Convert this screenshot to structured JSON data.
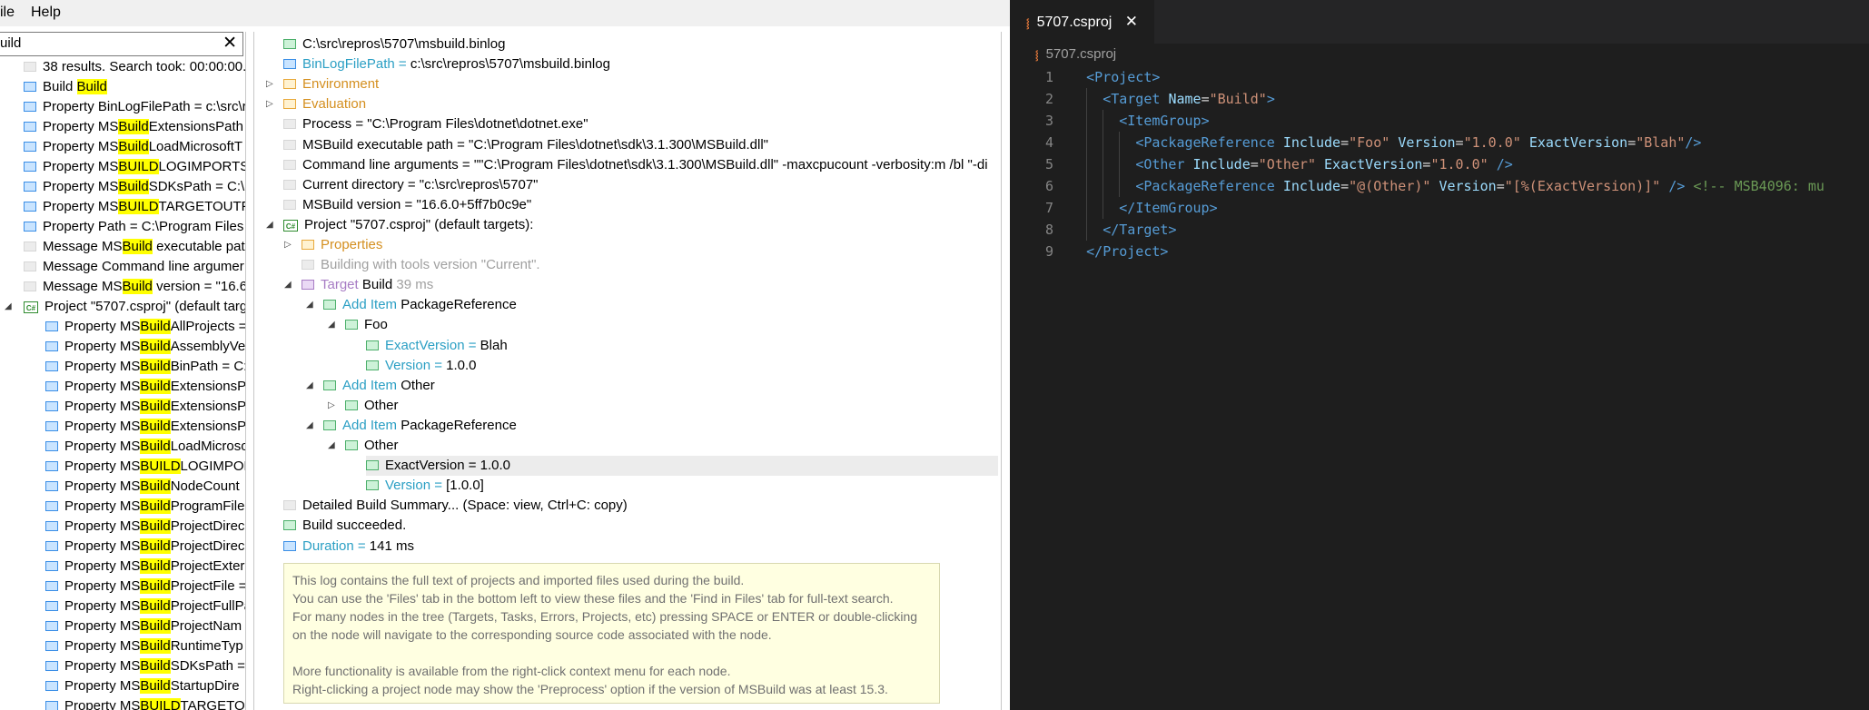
{
  "menu": {
    "file": "ile",
    "help": "Help"
  },
  "search": {
    "value": "uild",
    "clear_icon": "close-icon"
  },
  "search_results": [
    {
      "sq": "gray",
      "indent": 0,
      "parts": [
        {
          "t": "38 results. Search took: 00:00:00.0"
        }
      ]
    },
    {
      "sq": "blue",
      "indent": 0,
      "parts": [
        {
          "t": "Build "
        },
        {
          "t": "Build",
          "hl": true
        }
      ]
    },
    {
      "sq": "blue",
      "indent": 0,
      "parts": [
        {
          "t": "Property BinLogFilePath = c:\\src\\r"
        }
      ]
    },
    {
      "sq": "blue",
      "indent": 0,
      "parts": [
        {
          "t": "Property MS"
        },
        {
          "t": "Build",
          "hl": true
        },
        {
          "t": "ExtensionsPath"
        }
      ]
    },
    {
      "sq": "blue",
      "indent": 0,
      "parts": [
        {
          "t": "Property MS"
        },
        {
          "t": "Build",
          "hl": true
        },
        {
          "t": "LoadMicrosoftT"
        }
      ]
    },
    {
      "sq": "blue",
      "indent": 0,
      "parts": [
        {
          "t": "Property MS"
        },
        {
          "t": "BUILD",
          "hl": true
        },
        {
          "t": "LOGIMPORTS ="
        }
      ]
    },
    {
      "sq": "blue",
      "indent": 0,
      "parts": [
        {
          "t": "Property MS"
        },
        {
          "t": "Build",
          "hl": true
        },
        {
          "t": "SDKsPath = C:\\P"
        }
      ]
    },
    {
      "sq": "blue",
      "indent": 0,
      "parts": [
        {
          "t": "Property MS"
        },
        {
          "t": "BUILD",
          "hl": true
        },
        {
          "t": "TARGETOUTPU"
        }
      ]
    },
    {
      "sq": "blue",
      "indent": 0,
      "parts": [
        {
          "t": "Property Path = C:\\Program Files"
        }
      ]
    },
    {
      "sq": "gray",
      "indent": 0,
      "parts": [
        {
          "t": "Message MS"
        },
        {
          "t": "Build",
          "hl": true
        },
        {
          "t": " executable pat"
        }
      ]
    },
    {
      "sq": "gray",
      "indent": 0,
      "parts": [
        {
          "t": "Message Command line argumer"
        }
      ]
    },
    {
      "sq": "gray",
      "indent": 0,
      "parts": [
        {
          "t": "Message MS"
        },
        {
          "t": "Build",
          "hl": true
        },
        {
          "t": " version = \"16.6"
        }
      ]
    },
    {
      "sq": "cs",
      "indent": 0,
      "arrow": "expanded",
      "parts": [
        {
          "t": "Project \"5707.csproj\" (default targ"
        }
      ]
    },
    {
      "sq": "blue",
      "indent": 1,
      "parts": [
        {
          "t": "Property MS"
        },
        {
          "t": "Build",
          "hl": true
        },
        {
          "t": "AllProjects ="
        }
      ]
    },
    {
      "sq": "blue",
      "indent": 1,
      "parts": [
        {
          "t": "Property MS"
        },
        {
          "t": "Build",
          "hl": true
        },
        {
          "t": "AssemblyVe"
        }
      ]
    },
    {
      "sq": "blue",
      "indent": 1,
      "parts": [
        {
          "t": "Property MS"
        },
        {
          "t": "Build",
          "hl": true
        },
        {
          "t": "BinPath = C:"
        }
      ]
    },
    {
      "sq": "blue",
      "indent": 1,
      "parts": [
        {
          "t": "Property MS"
        },
        {
          "t": "Build",
          "hl": true
        },
        {
          "t": "ExtensionsPa"
        }
      ]
    },
    {
      "sq": "blue",
      "indent": 1,
      "parts": [
        {
          "t": "Property MS"
        },
        {
          "t": "Build",
          "hl": true
        },
        {
          "t": "ExtensionsPa"
        }
      ]
    },
    {
      "sq": "blue",
      "indent": 1,
      "parts": [
        {
          "t": "Property MS"
        },
        {
          "t": "Build",
          "hl": true
        },
        {
          "t": "ExtensionsPa"
        }
      ]
    },
    {
      "sq": "blue",
      "indent": 1,
      "parts": [
        {
          "t": "Property MS"
        },
        {
          "t": "Build",
          "hl": true
        },
        {
          "t": "LoadMicroso"
        }
      ]
    },
    {
      "sq": "blue",
      "indent": 1,
      "parts": [
        {
          "t": "Property MS"
        },
        {
          "t": "BUILD",
          "hl": true
        },
        {
          "t": "LOGIMPOR"
        }
      ]
    },
    {
      "sq": "blue",
      "indent": 1,
      "parts": [
        {
          "t": "Property MS"
        },
        {
          "t": "Build",
          "hl": true
        },
        {
          "t": "NodeCount"
        }
      ]
    },
    {
      "sq": "blue",
      "indent": 1,
      "parts": [
        {
          "t": "Property MS"
        },
        {
          "t": "Build",
          "hl": true
        },
        {
          "t": "ProgramFile"
        }
      ]
    },
    {
      "sq": "blue",
      "indent": 1,
      "parts": [
        {
          "t": "Property MS"
        },
        {
          "t": "Build",
          "hl": true
        },
        {
          "t": "ProjectDirec"
        }
      ]
    },
    {
      "sq": "blue",
      "indent": 1,
      "parts": [
        {
          "t": "Property MS"
        },
        {
          "t": "Build",
          "hl": true
        },
        {
          "t": "ProjectDirec"
        }
      ]
    },
    {
      "sq": "blue",
      "indent": 1,
      "parts": [
        {
          "t": "Property MS"
        },
        {
          "t": "Build",
          "hl": true
        },
        {
          "t": "ProjectExter"
        }
      ]
    },
    {
      "sq": "blue",
      "indent": 1,
      "parts": [
        {
          "t": "Property MS"
        },
        {
          "t": "Build",
          "hl": true
        },
        {
          "t": "ProjectFile ="
        }
      ]
    },
    {
      "sq": "blue",
      "indent": 1,
      "parts": [
        {
          "t": "Property MS"
        },
        {
          "t": "Build",
          "hl": true
        },
        {
          "t": "ProjectFullPa"
        }
      ]
    },
    {
      "sq": "blue",
      "indent": 1,
      "parts": [
        {
          "t": "Property MS"
        },
        {
          "t": "Build",
          "hl": true
        },
        {
          "t": "ProjectNam"
        }
      ]
    },
    {
      "sq": "blue",
      "indent": 1,
      "parts": [
        {
          "t": "Property MS"
        },
        {
          "t": "Build",
          "hl": true
        },
        {
          "t": "RuntimeTyp"
        }
      ]
    },
    {
      "sq": "blue",
      "indent": 1,
      "parts": [
        {
          "t": "Property MS"
        },
        {
          "t": "Build",
          "hl": true
        },
        {
          "t": "SDKsPath ="
        }
      ]
    },
    {
      "sq": "blue",
      "indent": 1,
      "parts": [
        {
          "t": "Property MS"
        },
        {
          "t": "Build",
          "hl": true
        },
        {
          "t": "StartupDire"
        }
      ]
    },
    {
      "sq": "blue",
      "indent": 1,
      "parts": [
        {
          "t": "Property MS"
        },
        {
          "t": "BUILD",
          "hl": true
        },
        {
          "t": "TARGETOU"
        }
      ]
    }
  ],
  "tree": [
    {
      "level": 0,
      "sq": "green",
      "parts": [
        {
          "t": "C:\\src\\repros\\5707\\msbuild.binlog"
        }
      ]
    },
    {
      "level": 0,
      "sq": "blue",
      "parts": [
        {
          "t": "BinLogFilePath = ",
          "c": "teal"
        },
        {
          "t": "c:\\src\\repros\\5707\\msbuild.binlog"
        }
      ]
    },
    {
      "level": 0,
      "sq": "orange",
      "arrow": "collapsed",
      "parts": [
        {
          "t": "Environment",
          "c": "orange-t"
        }
      ]
    },
    {
      "level": 0,
      "sq": "orange",
      "arrow": "collapsed",
      "parts": [
        {
          "t": "Evaluation",
          "c": "orange-t"
        }
      ]
    },
    {
      "level": 0,
      "sq": "gray",
      "parts": [
        {
          "t": "Process = \"C:\\Program Files\\dotnet\\dotnet.exe\""
        }
      ]
    },
    {
      "level": 0,
      "sq": "gray",
      "parts": [
        {
          "t": "MSBuild executable path = \"C:\\Program Files\\dotnet\\sdk\\3.1.300\\MSBuild.dll\""
        }
      ]
    },
    {
      "level": 0,
      "sq": "gray",
      "parts": [
        {
          "t": "Command line arguments = \"\"C:\\Program Files\\dotnet\\sdk\\3.1.300\\MSBuild.dll\" -maxcpucount -verbosity:m /bl \"-di"
        }
      ]
    },
    {
      "level": 0,
      "sq": "gray",
      "parts": [
        {
          "t": "Current directory = \"c:\\src\\repros\\5707\""
        }
      ]
    },
    {
      "level": 0,
      "sq": "gray",
      "parts": [
        {
          "t": "MSBuild version = \"16.6.0+5ff7b0c9e\""
        }
      ]
    },
    {
      "level": 0,
      "sq": "cs",
      "arrow": "expanded",
      "parts": [
        {
          "t": "Project \"5707.csproj\" (default targets):"
        }
      ]
    },
    {
      "level": 1,
      "sq": "orange",
      "arrow": "collapsed",
      "parts": [
        {
          "t": "Properties",
          "c": "orange-t"
        }
      ]
    },
    {
      "level": 1,
      "sq": "gray",
      "parts": [
        {
          "t": "Building with tools version \"Current\".",
          "c": "graytxt"
        }
      ]
    },
    {
      "level": 1,
      "sq": "purple",
      "arrow": "expanded",
      "parts": [
        {
          "t": "Target ",
          "c": "purple-t"
        },
        {
          "t": "Build"
        },
        {
          "t": "  39 ms",
          "c": "graytxt"
        }
      ]
    },
    {
      "level": 2,
      "sq": "green",
      "arrow": "expanded",
      "parts": [
        {
          "t": "Add Item ",
          "c": "teal"
        },
        {
          "t": "PackageReference"
        }
      ]
    },
    {
      "level": 3,
      "sq": "green",
      "arrow": "expanded",
      "parts": [
        {
          "t": "Foo"
        }
      ]
    },
    {
      "level": 4,
      "sq": "green",
      "parts": [
        {
          "t": "ExactVersion = ",
          "c": "teal"
        },
        {
          "t": "Blah"
        }
      ]
    },
    {
      "level": 4,
      "sq": "green",
      "parts": [
        {
          "t": "Version = ",
          "c": "teal"
        },
        {
          "t": "1.0.0"
        }
      ]
    },
    {
      "level": 2,
      "sq": "green",
      "arrow": "expanded",
      "parts": [
        {
          "t": "Add Item ",
          "c": "teal"
        },
        {
          "t": "Other"
        }
      ]
    },
    {
      "level": 3,
      "sq": "green",
      "arrow": "collapsed",
      "parts": [
        {
          "t": "Other"
        }
      ]
    },
    {
      "level": 2,
      "sq": "green",
      "arrow": "expanded",
      "parts": [
        {
          "t": "Add Item ",
          "c": "teal"
        },
        {
          "t": "PackageReference"
        }
      ]
    },
    {
      "level": 3,
      "sq": "green",
      "arrow": "expanded",
      "parts": [
        {
          "t": "Other"
        }
      ]
    },
    {
      "level": 4,
      "sq": "green",
      "selected": true,
      "parts": [
        {
          "t": "ExactVersion = 1.0.0"
        }
      ]
    },
    {
      "level": 4,
      "sq": "green",
      "parts": [
        {
          "t": "Version = ",
          "c": "teal"
        },
        {
          "t": "[1.0.0]"
        }
      ]
    },
    {
      "level": 0,
      "sq": "gray",
      "parts": [
        {
          "t": "Detailed Build Summary... (Space: view, Ctrl+C: copy)"
        }
      ]
    },
    {
      "level": 0,
      "sq": "green",
      "parts": [
        {
          "t": "Build succeeded."
        }
      ]
    },
    {
      "level": 0,
      "sq": "blue",
      "parts": [
        {
          "t": "Duration = ",
          "c": "teal"
        },
        {
          "t": "141 ms"
        }
      ]
    }
  ],
  "info": {
    "line1": "This log contains the full text of projects and imported files used during the build.",
    "line2": "You can use the 'Files' tab in the bottom left to view these files and the 'Find in Files' tab for full-text search.",
    "line3": "For many nodes in the tree (Targets, Tasks, Errors, Projects, etc) pressing SPACE or ENTER or double-clicking",
    "line4": "on the node will navigate to the corresponding source code associated with the node.",
    "line5": "More functionality is available from the right-click context menu for each node.",
    "line6": "Right-clicking a project node may show the 'Preprocess' option if the version of MSBuild was at least 15.3."
  },
  "editor": {
    "tab_title": "5707.csproj",
    "tab_icon": "rss-icon",
    "breadcrumb": "5707.csproj",
    "lines": [
      {
        "n": "1",
        "indent": 0,
        "tokens": [
          {
            "t": "<",
            "c": "tag"
          },
          {
            "t": "Project",
            "c": "tag"
          },
          {
            "t": ">",
            "c": "tag"
          }
        ]
      },
      {
        "n": "2",
        "indent": 1,
        "tokens": [
          {
            "t": "<",
            "c": "tag"
          },
          {
            "t": "Target",
            "c": "tag"
          },
          {
            "t": " "
          },
          {
            "t": "Name",
            "c": "attr"
          },
          {
            "t": "="
          },
          {
            "t": "\"Build\"",
            "c": "str"
          },
          {
            "t": ">",
            "c": "tag"
          }
        ]
      },
      {
        "n": "3",
        "indent": 2,
        "tokens": [
          {
            "t": "<",
            "c": "tag"
          },
          {
            "t": "ItemGroup",
            "c": "tag"
          },
          {
            "t": ">",
            "c": "tag"
          }
        ]
      },
      {
        "n": "4",
        "indent": 3,
        "tokens": [
          {
            "t": "<",
            "c": "tag"
          },
          {
            "t": "PackageReference",
            "c": "tag"
          },
          {
            "t": " "
          },
          {
            "t": "Include",
            "c": "attr"
          },
          {
            "t": "="
          },
          {
            "t": "\"Foo\"",
            "c": "str"
          },
          {
            "t": " "
          },
          {
            "t": "Version",
            "c": "attr"
          },
          {
            "t": "="
          },
          {
            "t": "\"1.0.0\"",
            "c": "str"
          },
          {
            "t": " "
          },
          {
            "t": "ExactVersion",
            "c": "attr"
          },
          {
            "t": "="
          },
          {
            "t": "\"Blah\"",
            "c": "str"
          },
          {
            "t": "/>",
            "c": "tag"
          }
        ]
      },
      {
        "n": "5",
        "indent": 3,
        "tokens": [
          {
            "t": "<",
            "c": "tag"
          },
          {
            "t": "Other",
            "c": "tag"
          },
          {
            "t": " "
          },
          {
            "t": "Include",
            "c": "attr"
          },
          {
            "t": "="
          },
          {
            "t": "\"Other\"",
            "c": "str"
          },
          {
            "t": " "
          },
          {
            "t": "ExactVersion",
            "c": "attr"
          },
          {
            "t": "="
          },
          {
            "t": "\"1.0.0\"",
            "c": "str"
          },
          {
            "t": " "
          },
          {
            "t": "/>",
            "c": "tag"
          }
        ]
      },
      {
        "n": "6",
        "indent": 3,
        "tokens": [
          {
            "t": "<",
            "c": "tag"
          },
          {
            "t": "PackageReference",
            "c": "tag"
          },
          {
            "t": " "
          },
          {
            "t": "Include",
            "c": "attr"
          },
          {
            "t": "="
          },
          {
            "t": "\"@(Other)\"",
            "c": "str"
          },
          {
            "t": " "
          },
          {
            "t": "Version",
            "c": "attr"
          },
          {
            "t": "="
          },
          {
            "t": "\"[%(ExactVersion)]\"",
            "c": "str"
          },
          {
            "t": " "
          },
          {
            "t": "/>",
            "c": "tag"
          },
          {
            "t": " "
          },
          {
            "t": "<!-- MSB4096: mu",
            "c": "cmt"
          }
        ]
      },
      {
        "n": "7",
        "indent": 2,
        "tokens": [
          {
            "t": "</",
            "c": "tag"
          },
          {
            "t": "ItemGroup",
            "c": "tag"
          },
          {
            "t": ">",
            "c": "tag"
          }
        ]
      },
      {
        "n": "8",
        "indent": 1,
        "tokens": [
          {
            "t": "</",
            "c": "tag"
          },
          {
            "t": "Target",
            "c": "tag"
          },
          {
            "t": ">",
            "c": "tag"
          }
        ]
      },
      {
        "n": "9",
        "indent": 0,
        "tokens": [
          {
            "t": "</",
            "c": "tag"
          },
          {
            "t": "Project",
            "c": "tag"
          },
          {
            "t": ">",
            "c": "tag"
          }
        ]
      }
    ]
  }
}
